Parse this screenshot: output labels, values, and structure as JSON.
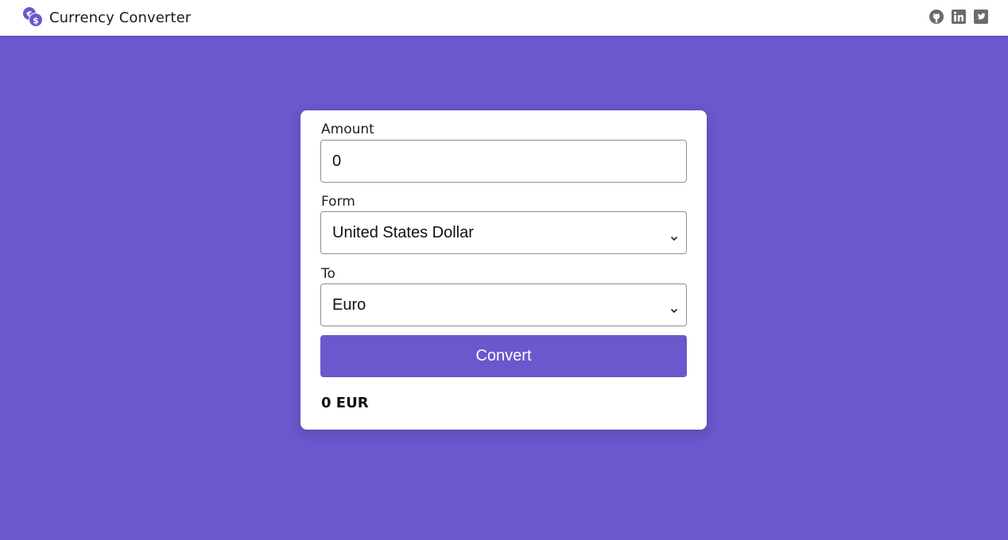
{
  "header": {
    "title": "Currency Converter",
    "logo_icon": "currency-exchange-icon",
    "social_icons": [
      "github-icon",
      "linkedin-icon",
      "twitter-icon"
    ]
  },
  "converter": {
    "amount_label": "Amount",
    "amount_value": "0",
    "from_label": "Form",
    "from_selected": "United States Dollar",
    "to_label": "To",
    "to_selected": "Euro",
    "convert_label": "Convert",
    "result_text": "0 EUR"
  },
  "colors": {
    "accent": "#6a58cc",
    "background": "#6a58cc",
    "card": "#ffffff"
  }
}
